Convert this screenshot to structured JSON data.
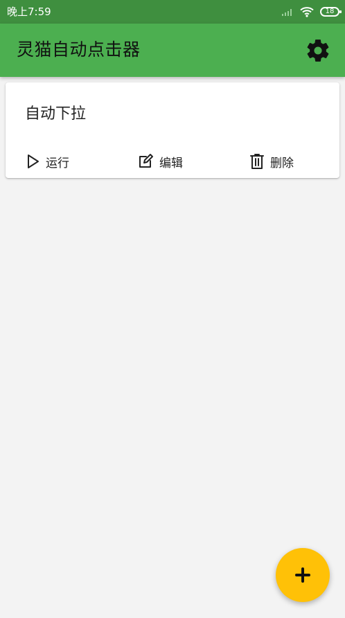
{
  "status_bar": {
    "time": "晚上7:59",
    "battery": "18",
    "icons": [
      "signal-icon",
      "wifi-icon",
      "battery-icon"
    ]
  },
  "app_bar": {
    "title": "灵猫自动点击器",
    "settings_icon": "gear-icon"
  },
  "tasks": [
    {
      "title": "自动下拉",
      "actions": {
        "run": "运行",
        "edit": "编辑",
        "delete": "删除"
      },
      "icons": {
        "run": "play-icon",
        "edit": "edit-icon",
        "delete": "trash-icon"
      }
    }
  ],
  "fab": {
    "icon": "plus-icon"
  },
  "colors": {
    "status_bar": "#3f8f3f",
    "app_bar": "#4caf50",
    "background": "#f3f3f3",
    "card": "#ffffff",
    "fab": "#ffc107",
    "text": "#222222"
  }
}
